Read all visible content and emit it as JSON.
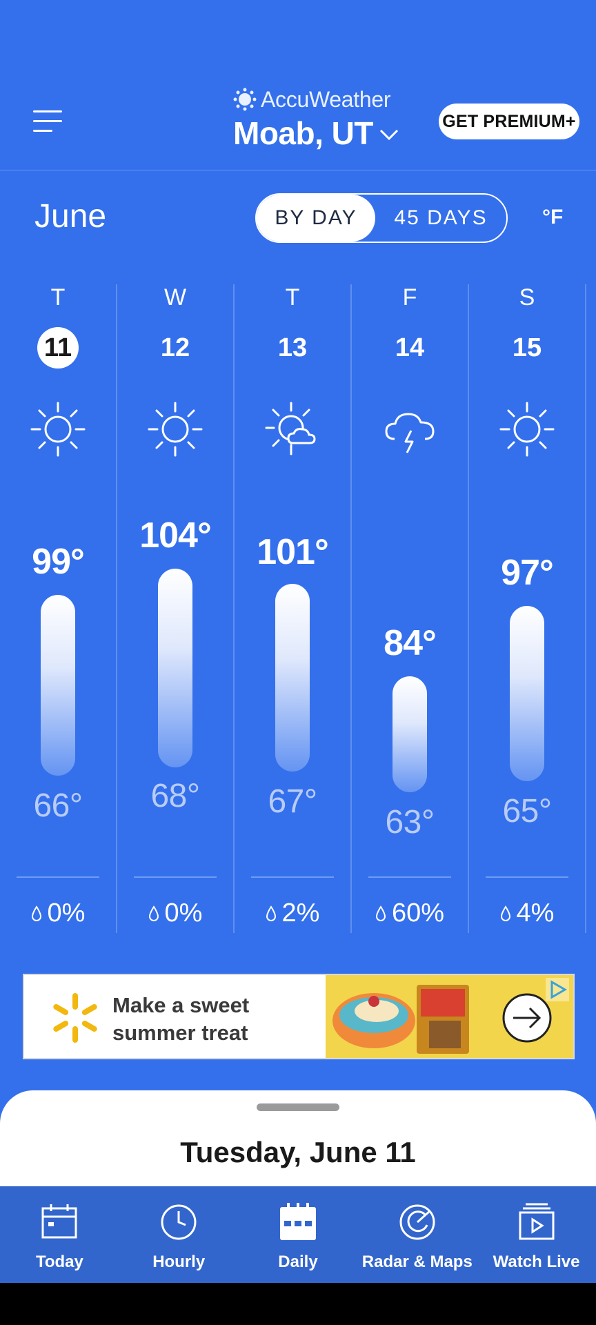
{
  "header": {
    "brand": "AccuWeather",
    "location": "Moab, UT",
    "premium_label": "GET PREMIUM+"
  },
  "controls": {
    "month": "June",
    "view_options": [
      "BY DAY",
      "45 DAYS"
    ],
    "selected_view": "BY DAY",
    "unit": "°F"
  },
  "days": [
    {
      "dow": "T",
      "date": "11",
      "icon": "sun-icon",
      "high": "99°",
      "low": "66°",
      "precip": "0%",
      "today": true
    },
    {
      "dow": "W",
      "date": "12",
      "icon": "sun-icon",
      "high": "104°",
      "low": "68°",
      "precip": "0%",
      "today": false
    },
    {
      "dow": "T",
      "date": "13",
      "icon": "partly-cloudy-icon",
      "high": "101°",
      "low": "67°",
      "precip": "2%",
      "today": false
    },
    {
      "dow": "F",
      "date": "14",
      "icon": "thunderstorm-icon",
      "high": "84°",
      "low": "63°",
      "precip": "60%",
      "today": false
    },
    {
      "dow": "S",
      "date": "15",
      "icon": "sun-icon",
      "high": "97°",
      "low": "65°",
      "precip": "4%",
      "today": false
    }
  ],
  "ad": {
    "text_line1": "Make a sweet",
    "text_line2": "summer treat"
  },
  "sheet": {
    "title": "Tuesday, June 11"
  },
  "tabs": [
    {
      "label": "Today",
      "icon": "calendar-icon"
    },
    {
      "label": "Hourly",
      "icon": "clock-icon"
    },
    {
      "label": "Daily",
      "icon": "calendar-grid-icon",
      "active": true
    },
    {
      "label": "Radar & Maps",
      "icon": "radar-icon"
    },
    {
      "label": "Watch Live",
      "icon": "play-video-icon"
    }
  ],
  "colors": {
    "background": "#3470ec",
    "tabbar": "#3366cc",
    "low_temp": "#b8ccf6",
    "ad_yellow": "#f3d54b"
  }
}
